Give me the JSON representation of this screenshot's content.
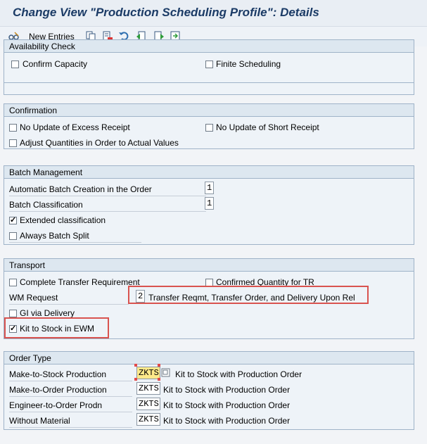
{
  "window": {
    "title": "Change View \"Production Scheduling Profile\": Details"
  },
  "toolbar": {
    "new_entries_label": "New Entries",
    "icons": [
      "glasses-edit-icon",
      "copy-icon",
      "delete-icon",
      "undo-icon",
      "prev-entry-icon",
      "next-entry-icon",
      "select-all-icon"
    ]
  },
  "availability": {
    "title": "Availability Check",
    "confirm_capacity": "Confirm Capacity",
    "finite_scheduling": "Finite Scheduling"
  },
  "confirmation": {
    "title": "Confirmation",
    "no_update_excess": "No Update of Excess Receipt",
    "no_update_short": "No Update of Short Receipt",
    "adjust_quantities": "Adjust Quantities in Order to Actual Values"
  },
  "batch": {
    "title": "Batch Management",
    "auto_creation_label": "Automatic Batch Creation in the Order",
    "auto_creation_value": "1",
    "classification_label": "Batch Classification",
    "classification_value": "1",
    "extended_classification": "Extended classification",
    "always_split": "Always Batch Split"
  },
  "transport": {
    "title": "Transport",
    "complete_transfer": "Complete Transfer Requirement",
    "confirmed_qty": "Confirmed Quantity for TR",
    "wm_request_label": "WM Request",
    "wm_request_value": "2",
    "wm_request_text": "Transfer Reqmt, Transfer Order, and Delivery Upon Rel",
    "gi_via_delivery": "GI via Delivery",
    "kit_to_stock": "Kit to Stock in EWM"
  },
  "order_type": {
    "title": "Order Type",
    "rows": [
      {
        "label": "Make-to-Stock Production",
        "value": "ZKTS",
        "desc": "Kit to Stock with Production Order"
      },
      {
        "label": "Make-to-Order Production",
        "value": "ZKTS",
        "desc": "Kit to Stock with Production Order"
      },
      {
        "label": "Engineer-to-Order Prodn",
        "value": "ZKTS",
        "desc": "Kit to Stock with Production Order"
      },
      {
        "label": "Without Material",
        "value": "ZKTS",
        "desc": "Kit to Stock with Production Order"
      }
    ]
  },
  "colors": {
    "title_text": "#1b3b66",
    "highlight_box": "#d9534f",
    "selected_field": "#ffe98a"
  }
}
